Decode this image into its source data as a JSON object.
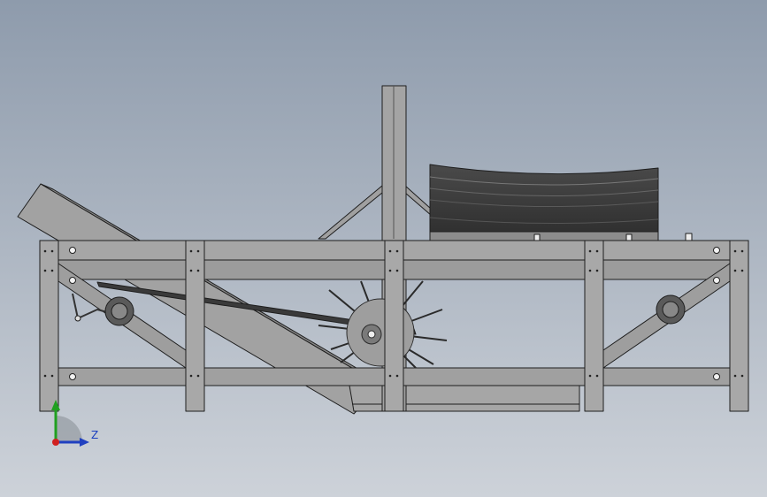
{
  "viewport": {
    "background_top": "#8e9bac",
    "background_bottom": "#c8ced6",
    "frame_color": "#9d9d9d",
    "frame_edge": "#2a2a2a",
    "dark_part": "#4a4a4a",
    "belt_color": "#3c3c3c"
  },
  "triad": {
    "z_label": "Z",
    "y_label": "",
    "colors": {
      "x": "#d02020",
      "y": "#20a020",
      "z": "#2040c0"
    }
  }
}
